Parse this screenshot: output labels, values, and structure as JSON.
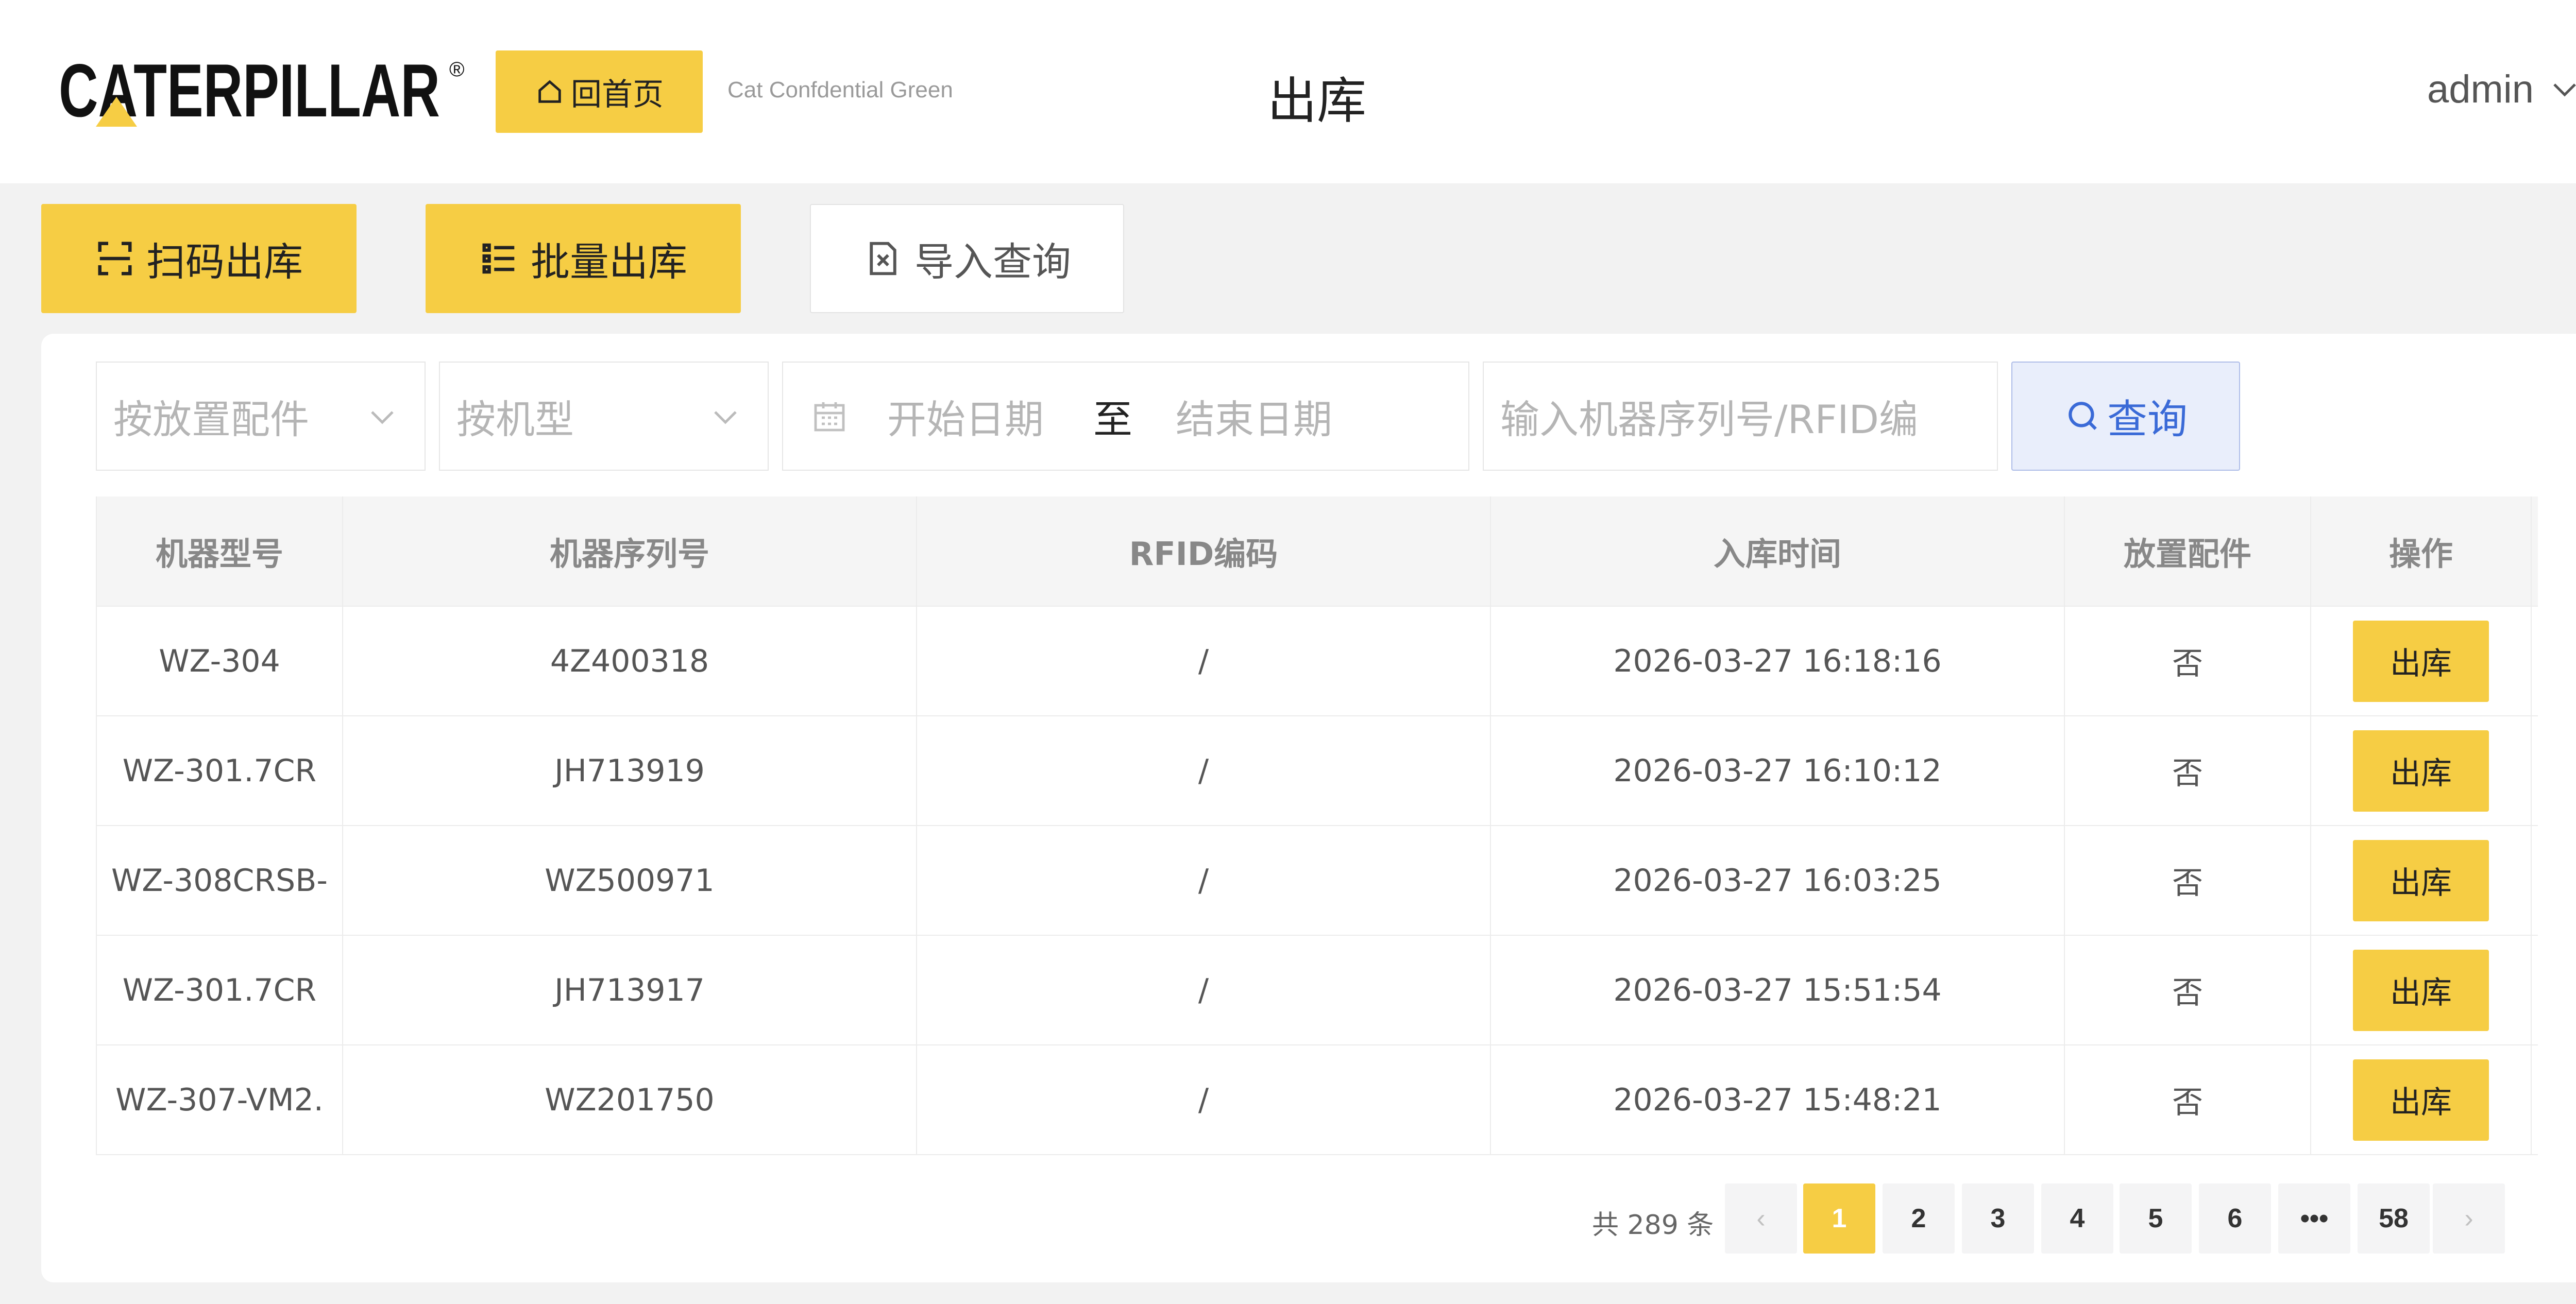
{
  "header": {
    "logo_text": "CATERPILLAR",
    "home_label": "回首页",
    "confidential": "Cat Confdential Green",
    "title": "出库",
    "user": "admin"
  },
  "tabs": {
    "scan": "扫码出库",
    "batch": "批量出库",
    "import": "导入查询"
  },
  "filters": {
    "accessory_placeholder": "按放置配件",
    "model_placeholder": "按机型",
    "start_date": "开始日期",
    "to": "至",
    "end_date": "结束日期",
    "search_placeholder": "输入机器序列号/RFID编",
    "query_label": "查询"
  },
  "table": {
    "columns": [
      "机器型号",
      "机器序列号",
      "RFID编码",
      "入库时间",
      "放置配件",
      "操作"
    ],
    "action_label": "出库",
    "rows": [
      {
        "model": "WZ-304",
        "serial": "4Z400318",
        "rfid": "/",
        "time": "2026-03-27 16:18:16",
        "accessory": "否"
      },
      {
        "model": "WZ-301.7CR",
        "serial": "JH713919",
        "rfid": "/",
        "time": "2026-03-27 16:10:12",
        "accessory": "否"
      },
      {
        "model": "WZ-308CRSB-",
        "serial": "WZ500971",
        "rfid": "/",
        "time": "2026-03-27 16:03:25",
        "accessory": "否"
      },
      {
        "model": "WZ-301.7CR",
        "serial": "JH713917",
        "rfid": "/",
        "time": "2026-03-27 15:51:54",
        "accessory": "否"
      },
      {
        "model": "WZ-307-VM2.",
        "serial": "WZ201750",
        "rfid": "/",
        "time": "2026-03-27 15:48:21",
        "accessory": "否"
      }
    ]
  },
  "pagination": {
    "total_text": "共 289 条",
    "prev": "‹",
    "next": "›",
    "pages": [
      "1",
      "2",
      "3",
      "4",
      "5",
      "6",
      "•••",
      "58"
    ],
    "current": "1"
  },
  "colors": {
    "brand_yellow": "#f6cd44",
    "query_blue": "#3a6ad7"
  }
}
